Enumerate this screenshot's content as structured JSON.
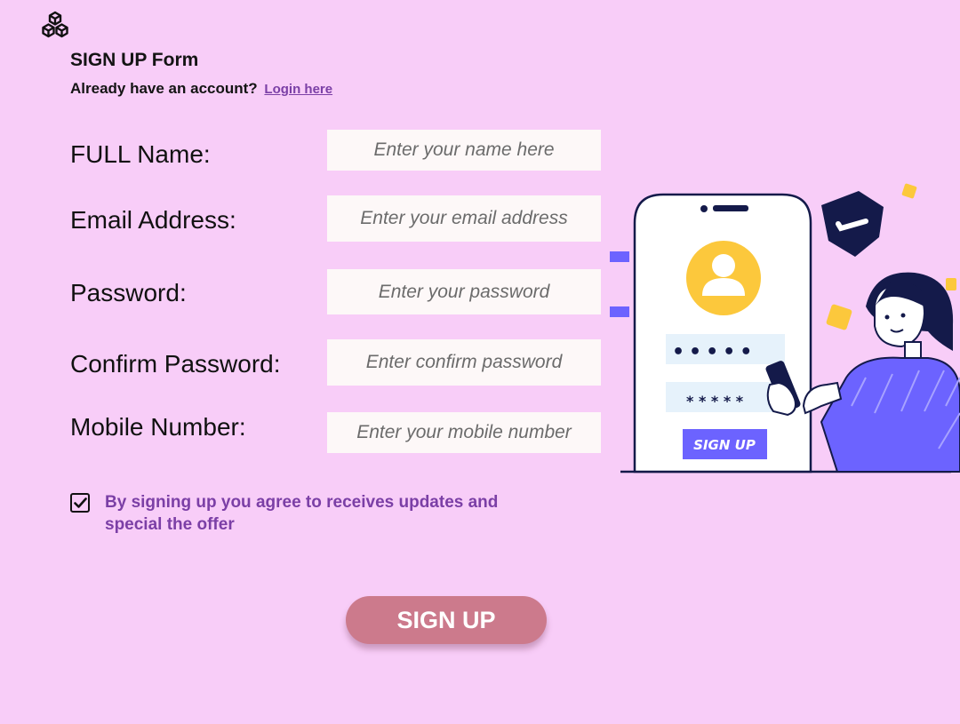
{
  "header": {
    "logo_icon": "cubes-logo-icon",
    "title": "SIGN UP Form",
    "already_text": "Already have an account?",
    "login_link": "Login here"
  },
  "form": {
    "fields": [
      {
        "label": "FULL Name:",
        "placeholder": "Enter your name here"
      },
      {
        "label": "Email Address:",
        "placeholder": "Enter your email address"
      },
      {
        "label": "Password:",
        "placeholder": "Enter your password"
      },
      {
        "label": "Confirm Password:",
        "placeholder": "Enter confirm password"
      },
      {
        "label": "Mobile Number:",
        "placeholder": "Enter your mobile number"
      }
    ],
    "agree": {
      "checked": true,
      "text": "By signing up you agree to receives updates and special the offer"
    },
    "submit_label": "SIGN UP"
  },
  "illustration": {
    "password_dots": "•••••",
    "password_stars": "* * * * *",
    "button_label": "SIGN UP"
  },
  "colors": {
    "background": "#f8cdf8",
    "accent_purple": "#7b3fa6",
    "submit_button": "#cc7a8c",
    "illustration_purple": "#6c63ff",
    "avatar_yellow": "#fcc83c",
    "navy": "#141a4a"
  }
}
